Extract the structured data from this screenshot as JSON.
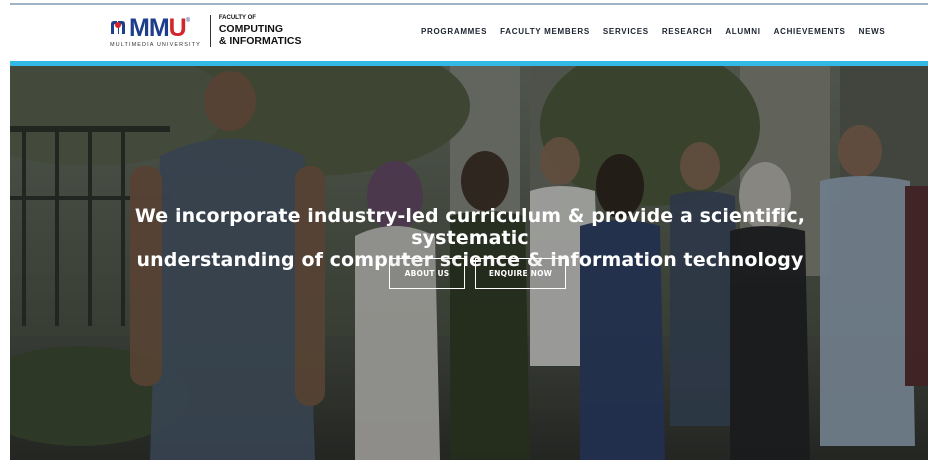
{
  "logo": {
    "brand": "MMU",
    "subtitle": "MULTIMEDIA UNIVERSITY",
    "faculty_of": "FACULTY OF",
    "faculty_line1": "COMPUTING",
    "faculty_line2": "& INFORMATICS"
  },
  "nav": {
    "items": [
      "PROGRAMMES",
      "FACULTY MEMBERS",
      "SERVICES",
      "RESEARCH",
      "ALUMNI",
      "ACHIEVEMENTS",
      "NEWS"
    ]
  },
  "hero": {
    "headline_line1": "We incorporate industry-led curriculum & provide a scientific, systematic",
    "headline_line2": "understanding of computer science & information technology",
    "about_label": "ABOUT US",
    "enquire_label": "ENQUIRE NOW"
  },
  "colors": {
    "brand_blue": "#1d3e8c",
    "brand_red": "#d3262c",
    "accent_cyan": "#33b9e5"
  }
}
